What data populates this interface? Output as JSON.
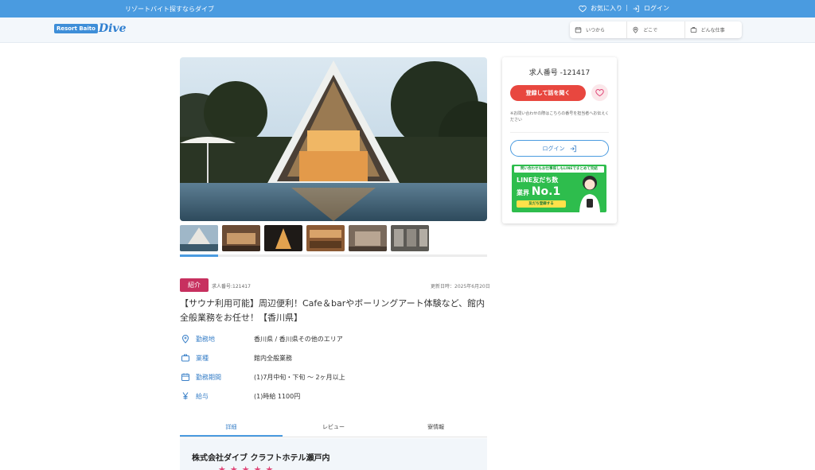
{
  "topbar": {
    "tagline": "リゾートバイト探すならダイブ",
    "favorites_label": "お気に入り",
    "separator": "|",
    "login_label": "ログイン"
  },
  "header": {
    "logo_box": "Resort Baito",
    "logo_word": "Dive",
    "search": {
      "when": "いつから",
      "where": "どこで",
      "what": "どんな仕事"
    }
  },
  "job": {
    "badge": "紹介",
    "job_number": "求人番号:121417",
    "updated": "更新日時：2025年6月20日",
    "title": "【サウナ利用可能】周辺便利！Cafe＆barやボーリングアート体験など、館内全般業務をお任せ！【香川県】",
    "details": [
      {
        "label": "勤務地",
        "value": "香川県 / 香川県その他のエリア",
        "icon": "map-pin-icon"
      },
      {
        "label": "業種",
        "value": "館内全般業務",
        "icon": "briefcase-icon"
      },
      {
        "label": "勤務期間",
        "value": "(1)7月中旬・下旬 〜 2ヶ月以上",
        "icon": "calendar-icon"
      },
      {
        "label": "給与",
        "value": "(1)時給 1100円",
        "icon": "yen-icon"
      }
    ]
  },
  "tabs": [
    {
      "label": "詳細"
    },
    {
      "label": "レビュー"
    },
    {
      "label": "寮情報"
    }
  ],
  "company": {
    "name": "株式会社ダイブ クラフトホテル瀬戸内",
    "rating_stars": 5
  },
  "sidebar": {
    "job_number": "求人番号 -121417",
    "apply_label": "登録して話を聞く",
    "note": "※お問い合わせの際はこちらの番号を担当者へお伝えください",
    "login_label": "ログイン",
    "line_banner": {
      "top": "問い合わせもお仕事探しもLINEでまとめて完結",
      "line1": "LINE友だち数",
      "line2_prefix": "業界",
      "line2_big": "No.1",
      "cta": "友だち登録する"
    }
  },
  "colors": {
    "brand_blue": "#4a9be0",
    "apply_red": "#e8473f",
    "badge_pink": "#c7305f",
    "line_green": "#2ebd4d",
    "star_pink": "#e04778"
  }
}
